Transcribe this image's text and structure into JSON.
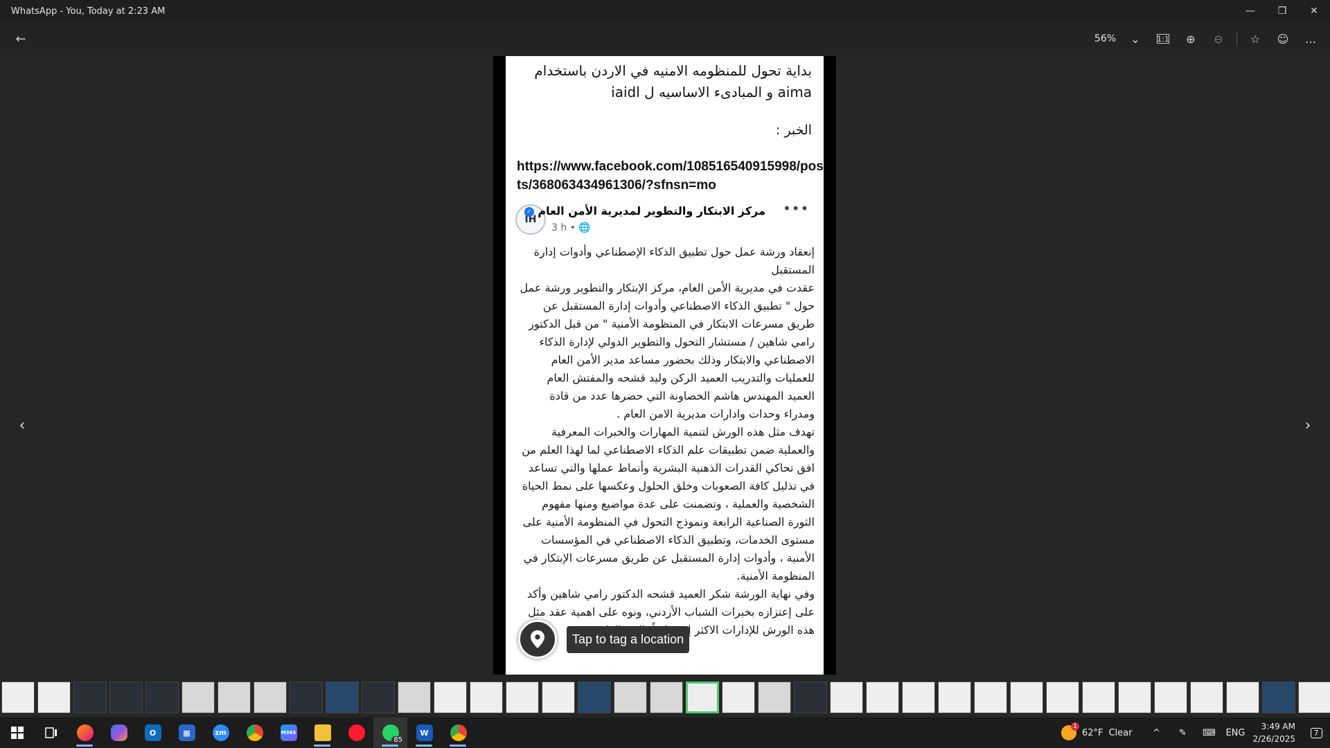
{
  "window": {
    "title": "WhatsApp - You, Today at 2:23 AM",
    "minimize": "—",
    "maximize": "❐",
    "close": "✕"
  },
  "toolbar": {
    "back_icon": "←",
    "zoom": "56%",
    "zoom_chevron": "⌄",
    "actual_size_icon": "1:1",
    "zoom_in_icon": "⊕",
    "zoom_out_icon": "⊖",
    "star_icon": "☆",
    "emoji_icon": "☺",
    "more_icon": "…"
  },
  "viewer": {
    "prev_icon": "‹",
    "next_icon": "›"
  },
  "document": {
    "headline": "بداية تحول للمنظومه الامنيه في الاردن باستخدام aima و المبادىء الاساسيه ل iaidl",
    "news_label": "الخبر :",
    "link": "https://www.facebook.com/108516540915998/posts/368063434961306/?sfnsn=mo",
    "post": {
      "page_name": "مركز الابتكار والتطوير لمديرية الأمن العام",
      "avatar_text": "IH",
      "time": "3 h • 🌐",
      "more": "•••",
      "paragraphs": [
        "إنعقاد ورشة عمل حول تطبيق الذكاء الإصطناعي وأدوات إدارة المستقبل",
        "عقدت في مديرية الأمن العام، مركز الإبتكار والتطوير ورشة عمل حول \" تطبيق الذكاء الاصطناعي وأدوات إدارة المستقبل عن طريق مسرعات الابتكار في المنظومة الأمنية \" من قبل الدكتور رامي شاهين / مستشار التحول والتطوير الدولي لإدارة الذكاء الاصطناعي والابتكار وذلك بحضور مساعد مدير الأمن العام للعمليات والتدريب العميد الركن وليد قشحه والمفتش العام العميد المهندس هاشم الخصاونة التي حضرها عدد من قادة ومدراء وحدات وادارات مديرية الامن العام .",
        "تهدف مثل هذه الورش لتنمية المهارات والخبرات المعرفية والعملية ضمن تطبيقات علم الذكاء الاصطناعي لما لهذا العلم من افق تحاكي القدرات الذهنية البشرية وأنماط عملها والتي تساعد في تذليل كافة الصعوبات وخلق الحلول وعكسها على نمط الحياة الشخصية والعملية ، وتضمنت على عدة مواضيع ومنها مفهوم الثورة الصناعية الرابعة ونموذج التحول في المنظومة الأمنية على مستوى الخدمات، وتطبيق الذكاء الاصطناعي في المؤسسات الأمنية ، وأدوات إدارة المستقبل عن طريق مسرعات الإبتكار في المنظومة الأمنية.",
        "وفي نهاية الورشة شكر العميد قشحه الدكتور رامي شاهين وأكد على إعتزازه بخبرات الشباب الأردني، ونوه على اهمية عقد مثل هذه الورش للإدارات الاكثر إختصاصاً بالـ... العام"
      ]
    }
  },
  "location_tag": {
    "icon": "location-pin-icon",
    "text": "Tap to tag a location"
  },
  "taskbar": {
    "whatsapp_count": "85",
    "weather_alert": "1",
    "temperature": "62°F",
    "condition": "Clear",
    "tray_chevron": "^",
    "language": "ENG",
    "time": "3:49 AM",
    "date": "2/26/2025",
    "notifications": "7",
    "zoom_app": "zm",
    "word_app": "W",
    "copilot_m365": "M365"
  }
}
